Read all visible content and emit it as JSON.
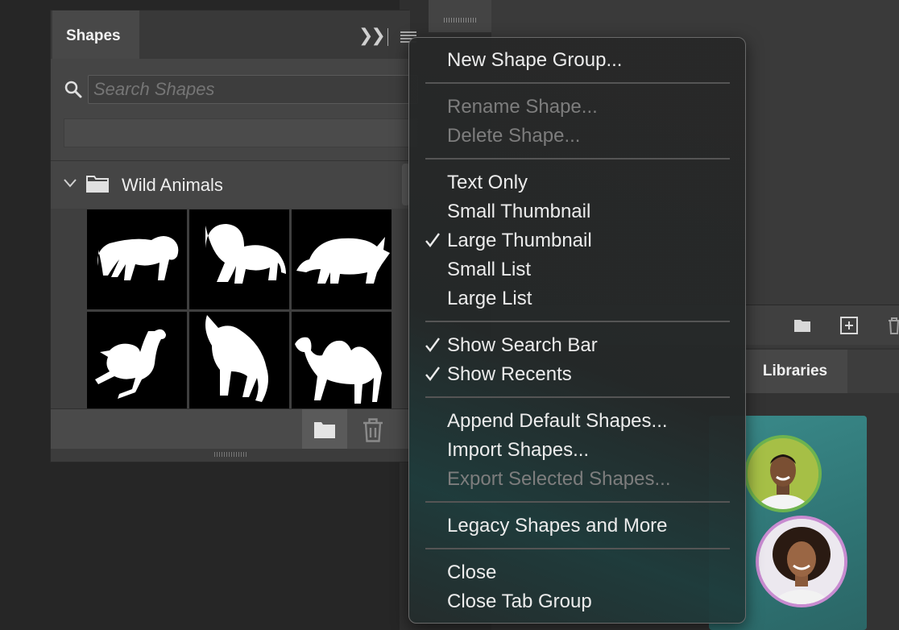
{
  "shapes_panel": {
    "tab_label": "Shapes",
    "search": {
      "placeholder": "Search Shapes",
      "value": ""
    },
    "group": {
      "label": "Wild Animals",
      "expanded": true
    },
    "thumbnails": [
      "tiger-icon",
      "lion-icon",
      "rhino-icon",
      "ostrich-icon",
      "fox-icon",
      "camel-icon"
    ]
  },
  "libraries_panel": {
    "tab_label": "Libraries"
  },
  "menu": {
    "items": [
      {
        "label": "New Shape Group...",
        "enabled": true,
        "checked": false
      },
      {
        "label": "Rename Shape...",
        "enabled": false,
        "checked": false
      },
      {
        "label": "Delete Shape...",
        "enabled": false,
        "checked": false
      },
      {
        "label": "Text Only",
        "enabled": true,
        "checked": false
      },
      {
        "label": "Small Thumbnail",
        "enabled": true,
        "checked": false
      },
      {
        "label": "Large Thumbnail",
        "enabled": true,
        "checked": true
      },
      {
        "label": "Small List",
        "enabled": true,
        "checked": false
      },
      {
        "label": "Large List",
        "enabled": true,
        "checked": false
      },
      {
        "label": "Show Search Bar",
        "enabled": true,
        "checked": true
      },
      {
        "label": "Show Recents",
        "enabled": true,
        "checked": true
      },
      {
        "label": "Append Default Shapes...",
        "enabled": true,
        "checked": false
      },
      {
        "label": "Import Shapes...",
        "enabled": true,
        "checked": false
      },
      {
        "label": "Export Selected Shapes...",
        "enabled": false,
        "checked": false
      },
      {
        "label": "Legacy Shapes and More",
        "enabled": true,
        "checked": false
      },
      {
        "label": "Close",
        "enabled": true,
        "checked": false
      },
      {
        "label": "Close Tab Group",
        "enabled": true,
        "checked": false
      }
    ]
  },
  "colors": {
    "menu_bg": "#282828",
    "disabled_text": "#7d7d7d",
    "panel_bg": "#454545"
  }
}
